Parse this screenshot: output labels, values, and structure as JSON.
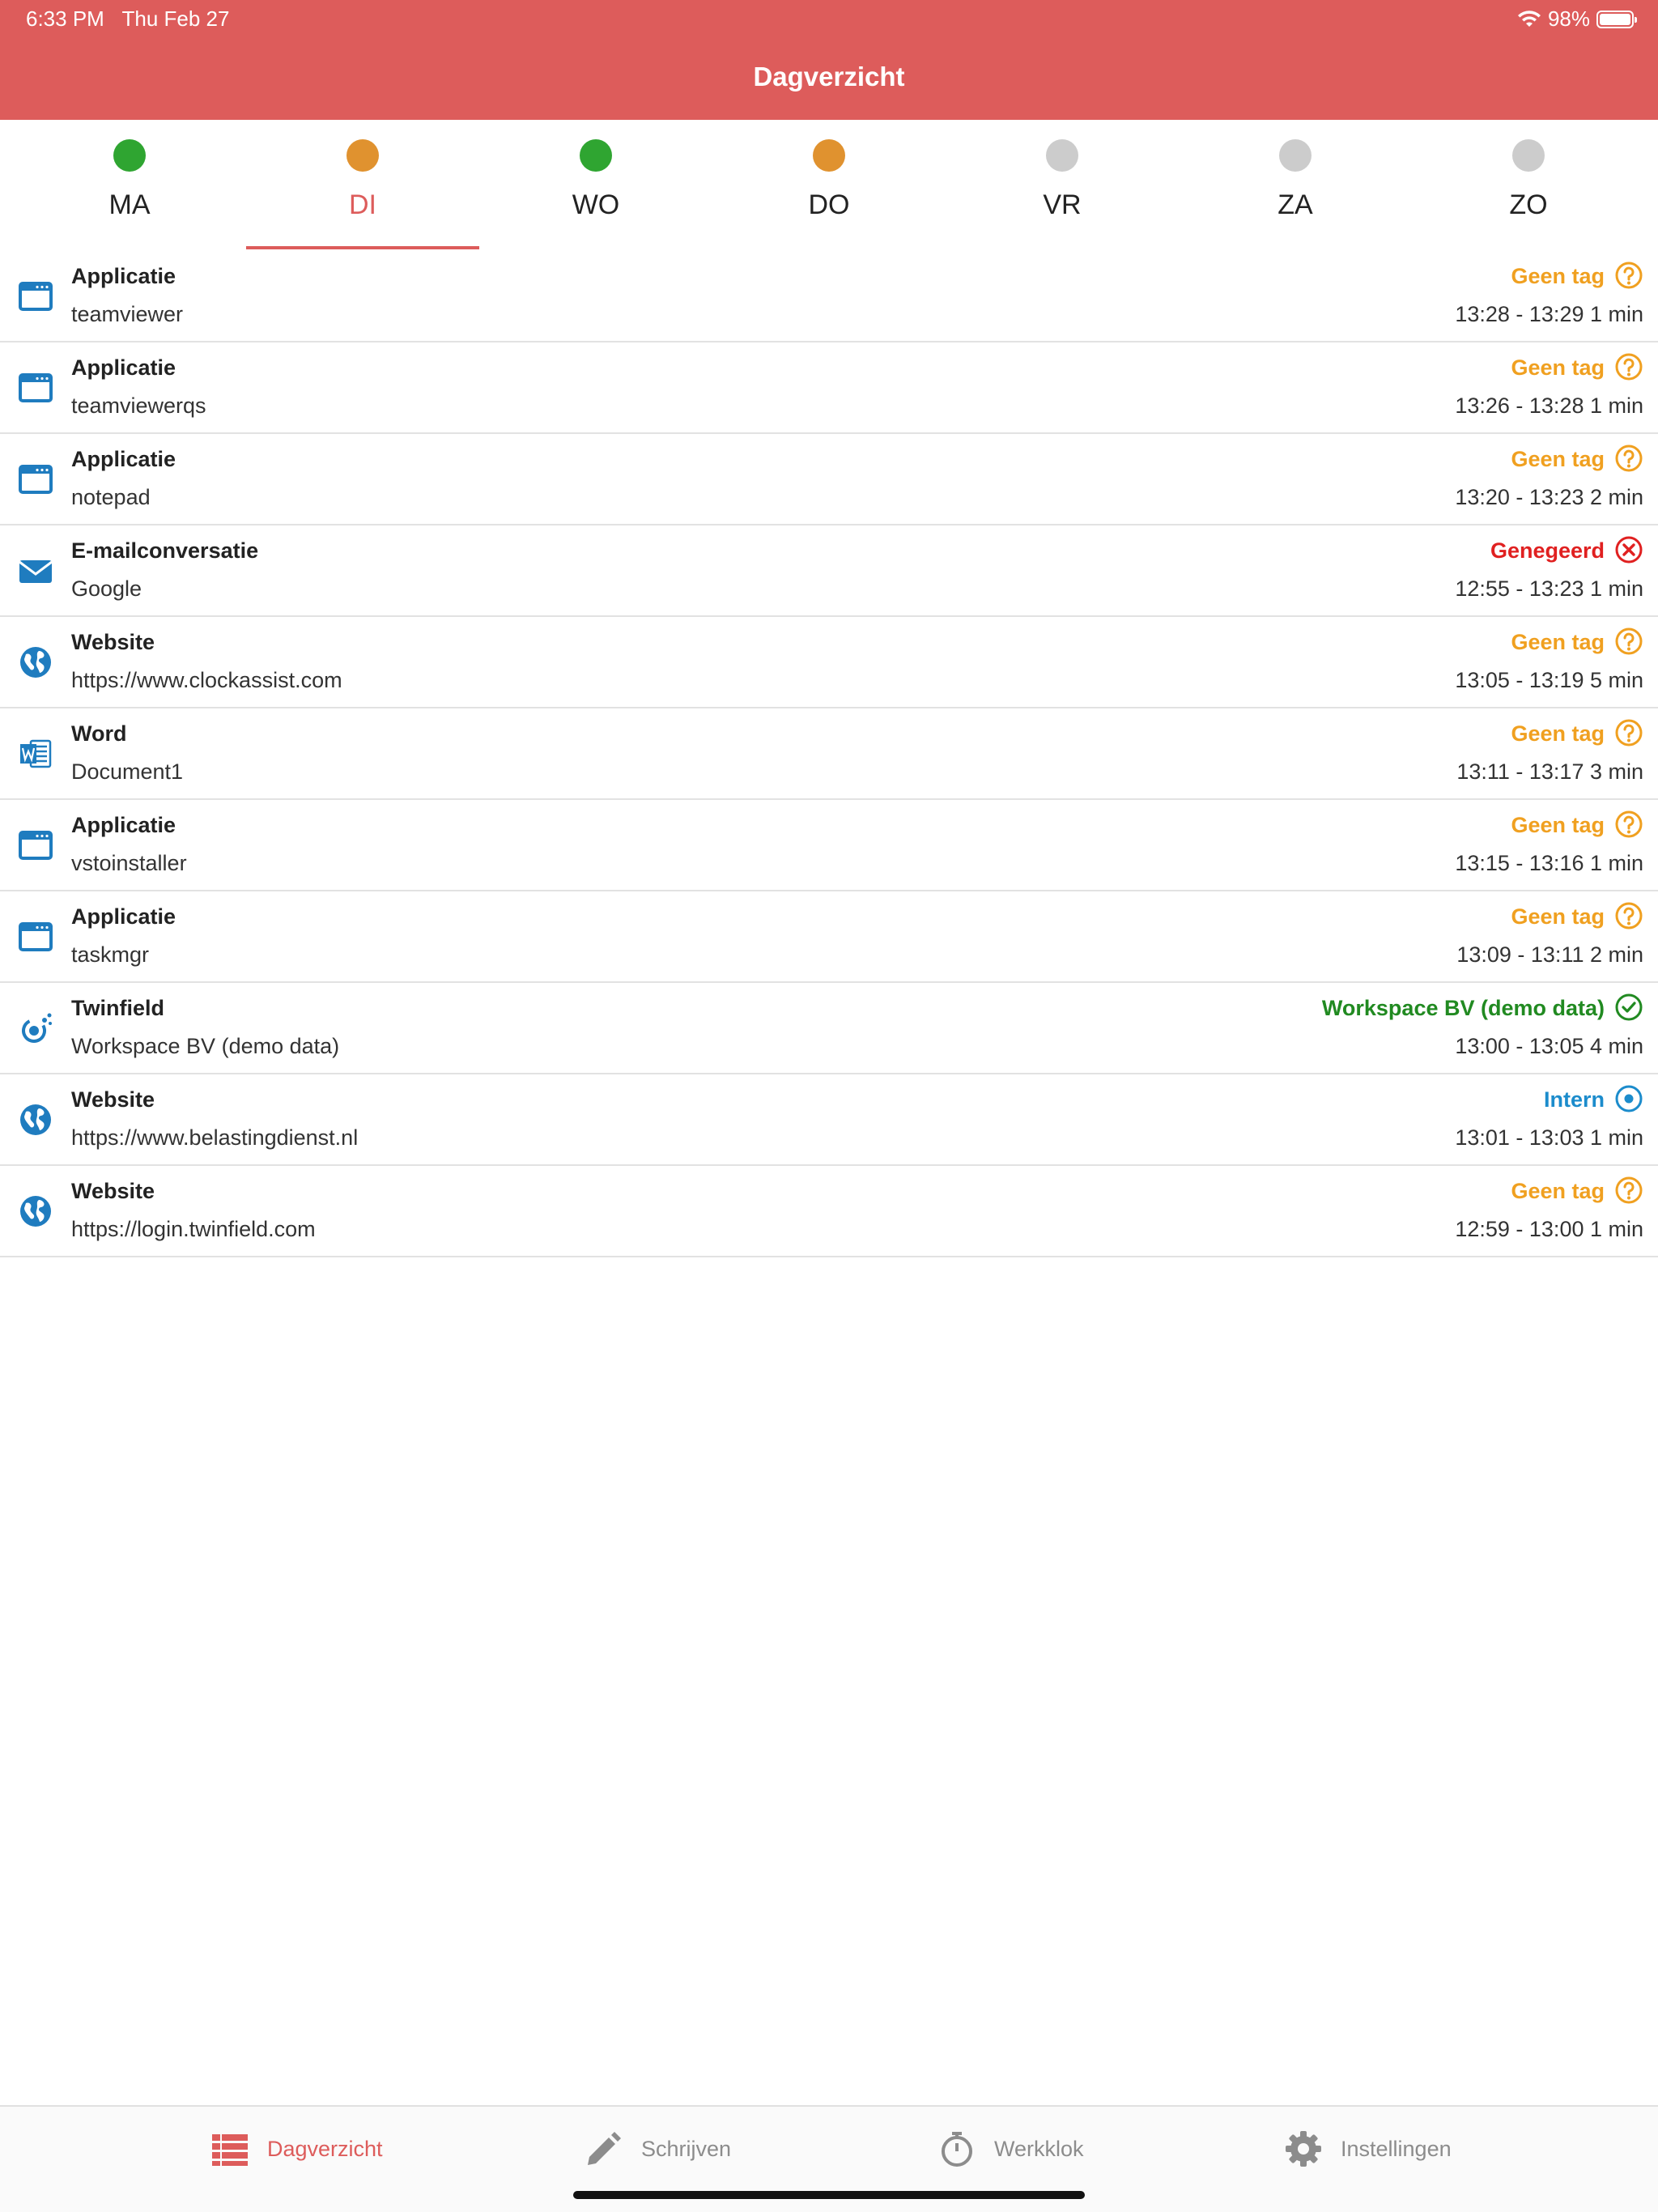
{
  "status": {
    "time": "6:33 PM",
    "date": "Thu Feb 27",
    "battery": "98%"
  },
  "header": {
    "title": "Dagverzicht"
  },
  "days": [
    {
      "label": "MA",
      "dot_color": "#2fa531"
    },
    {
      "label": "DI",
      "dot_color": "#e0922f",
      "active": true
    },
    {
      "label": "WO",
      "dot_color": "#2fa531"
    },
    {
      "label": "DO",
      "dot_color": "#e0922f"
    },
    {
      "label": "VR",
      "dot_color": "#cccccc"
    },
    {
      "label": "ZA",
      "dot_color": "#cccccc"
    },
    {
      "label": "ZO",
      "dot_color": "#cccccc"
    }
  ],
  "colors": {
    "accent": "#dd5c5b",
    "icon_blue": "#1f7cbf",
    "tag_none": "#f0a020",
    "tag_ignored": "#e02020",
    "tag_project": "#218a21",
    "tag_intern": "#1c8ccc"
  },
  "activities": [
    {
      "type": "Applicatie",
      "name": "teamviewer",
      "icon": "app-window-icon",
      "tag": "Geen tag",
      "tag_kind": "none",
      "time": "13:28 - 13:29 1 min"
    },
    {
      "type": "Applicatie",
      "name": "teamviewerqs",
      "icon": "app-window-icon",
      "tag": "Geen tag",
      "tag_kind": "none",
      "time": "13:26 - 13:28 1 min"
    },
    {
      "type": "Applicatie",
      "name": "notepad",
      "icon": "app-window-icon",
      "tag": "Geen tag",
      "tag_kind": "none",
      "time": "13:20 - 13:23 2 min"
    },
    {
      "type": "E-mailconversatie",
      "name": "Google",
      "icon": "mail-icon",
      "tag": "Genegeerd",
      "tag_kind": "ignored",
      "time": "12:55 - 13:23 1 min"
    },
    {
      "type": "Website",
      "name": "https://www.clockassist.com",
      "icon": "globe-icon",
      "tag": "Geen tag",
      "tag_kind": "none",
      "time": "13:05 - 13:19 5 min"
    },
    {
      "type": "Word",
      "name": "Document1",
      "icon": "word-icon",
      "tag": "Geen tag",
      "tag_kind": "none",
      "time": "13:11 - 13:17 3 min"
    },
    {
      "type": "Applicatie",
      "name": "vstoinstaller",
      "icon": "app-window-icon",
      "tag": "Geen tag",
      "tag_kind": "none",
      "time": "13:15 - 13:16 1 min"
    },
    {
      "type": "Applicatie",
      "name": "taskmgr",
      "icon": "app-window-icon",
      "tag": "Geen tag",
      "tag_kind": "none",
      "time": "13:09 - 13:11 2 min"
    },
    {
      "type": "Twinfield",
      "name": "Workspace BV (demo data)",
      "icon": "twinfield-icon",
      "tag": "Workspace BV (demo data)",
      "tag_kind": "project",
      "time": "13:00 - 13:05 4 min"
    },
    {
      "type": "Website",
      "name": "https://www.belastingdienst.nl",
      "icon": "globe-icon",
      "tag": "Intern",
      "tag_kind": "intern",
      "time": "13:01 - 13:03 1 min"
    },
    {
      "type": "Website",
      "name": "https://login.twinfield.com",
      "icon": "globe-icon",
      "tag": "Geen tag",
      "tag_kind": "none",
      "time": "12:59 - 13:00 1 min"
    }
  ],
  "tabbar": {
    "items": [
      {
        "label": "Dagverzicht",
        "icon": "list-icon",
        "active": true
      },
      {
        "label": "Schrijven",
        "icon": "pencil-icon"
      },
      {
        "label": "Werkklok",
        "icon": "stopwatch-icon"
      },
      {
        "label": "Instellingen",
        "icon": "gear-icon"
      }
    ]
  }
}
